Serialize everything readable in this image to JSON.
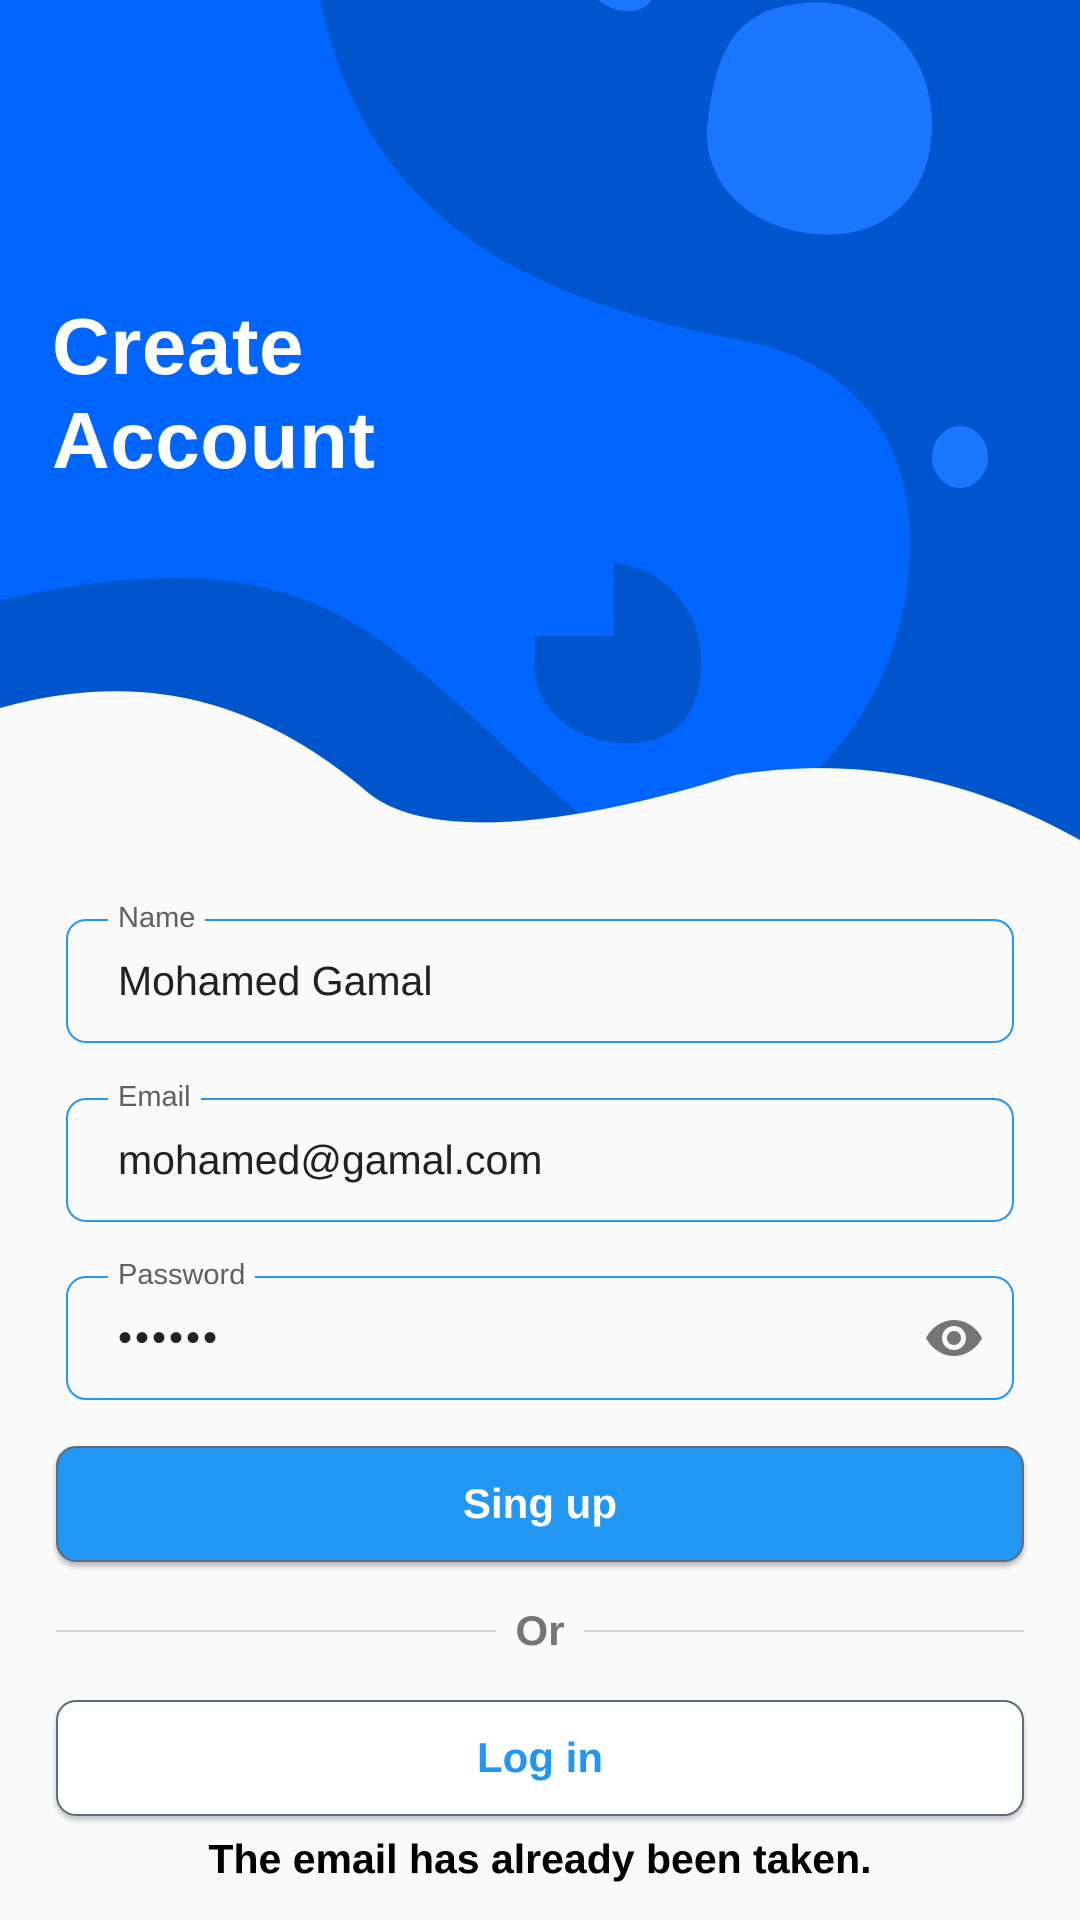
{
  "colors": {
    "hero_base": "#0066ff",
    "hero_shape": "#0055cc",
    "background": "#fafafa",
    "accent": "#2196f3",
    "field_label": "#616161",
    "icon": "#757575"
  },
  "header": {
    "title_line1": "Create",
    "title_line2": "Account"
  },
  "form": {
    "name": {
      "label": "Name",
      "value": "Mohamed Gamal"
    },
    "email": {
      "label": "Email",
      "value": "mohamed@gamal.com"
    },
    "password": {
      "label": "Password",
      "value": "••••••",
      "toggle_icon": "eye-icon"
    }
  },
  "actions": {
    "signup_label": "Sing up",
    "divider_label": "Or",
    "login_label": "Log in"
  },
  "message": {
    "error": "The email has already been taken."
  }
}
